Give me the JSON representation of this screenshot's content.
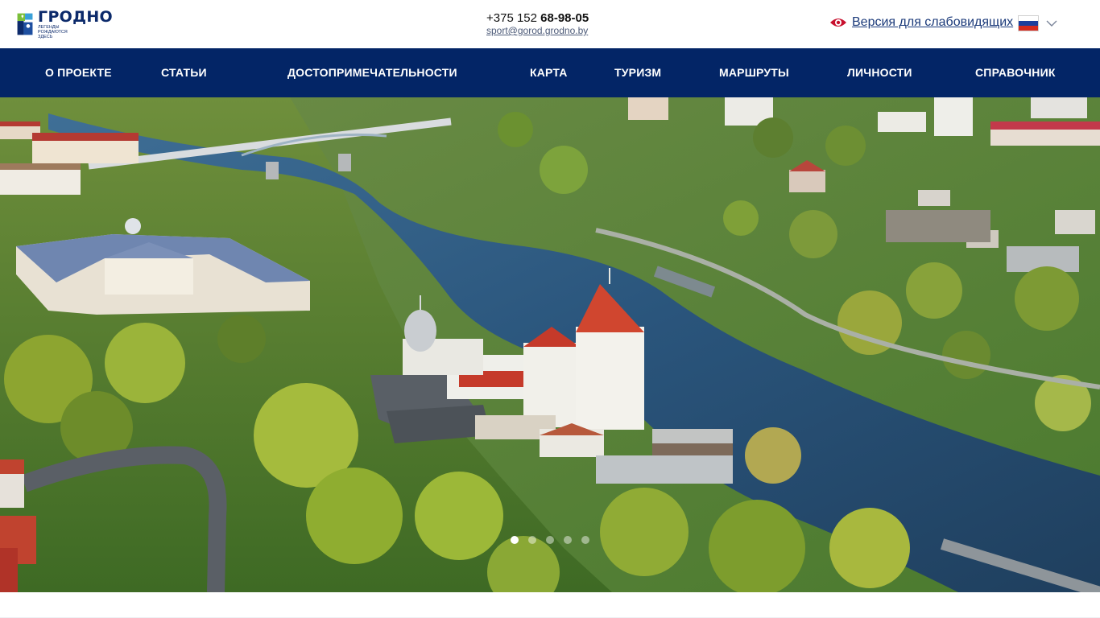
{
  "header": {
    "logo": {
      "name": "ГРОДНО",
      "tagline": "ЛЕГЕНДЫ РОЖДАЮТСЯ ЗДЕСЬ"
    },
    "contacts": {
      "phone_prefix": "+375 152 ",
      "phone_main": "68-98-05",
      "email": "sport@gorod.grodno.by"
    },
    "accessibility_label": "Версия для слабовидящих",
    "language": "ru"
  },
  "nav": {
    "items": [
      {
        "label": "О ПРОЕКТЕ"
      },
      {
        "label": "СТАТЬИ"
      },
      {
        "label": "ДОСТОПРИМЕЧАТЕЛЬНОСТИ"
      },
      {
        "label": "КАРТА"
      },
      {
        "label": "ТУРИЗМ"
      },
      {
        "label": "МАРШРУТЫ"
      },
      {
        "label": "ЛИЧНОСТИ"
      },
      {
        "label": "СПРАВОЧНИК"
      }
    ]
  },
  "slider": {
    "slide_count": 5,
    "active_index": 0
  },
  "colors": {
    "nav_bg": "#032566",
    "accent_red": "#c8102e",
    "brand_blue": "#0c2a6b"
  }
}
